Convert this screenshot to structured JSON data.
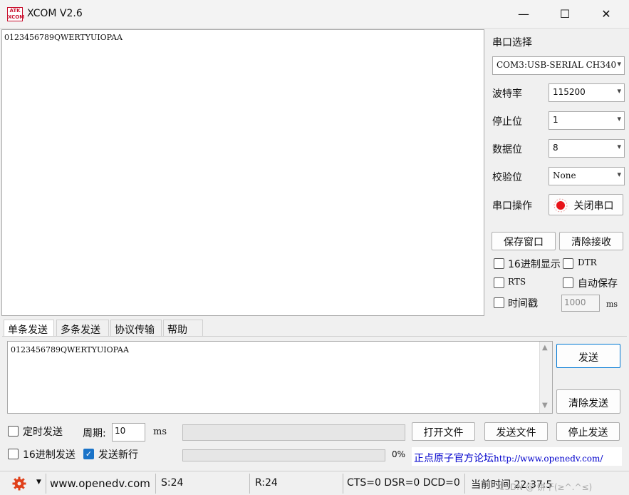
{
  "window": {
    "logo_text": "ATK XCOM",
    "title": "XCOM V2.6",
    "minimize": "—",
    "maximize": "☐",
    "close": "✕"
  },
  "receive": {
    "text": "0123456789QWERTYUIOPAA"
  },
  "panel": {
    "port_select_label": "串口选择",
    "port_value": "COM3:USB-SERIAL CH340",
    "baud_label": "波特率",
    "baud_value": "115200",
    "stop_label": "停止位",
    "stop_value": "1",
    "data_label": "数据位",
    "data_value": "8",
    "parity_label": "校验位",
    "parity_value": "None",
    "op_label": "串口操作",
    "op_button": "关闭串口",
    "save_window": "保存窗口",
    "clear_receive": "清除接收",
    "hex_display": "16进制显示",
    "dtr": "DTR",
    "rts": "RTS",
    "auto_save": "自动保存",
    "timestamp": "时间戳",
    "timestamp_ms_value": "1000",
    "ms_unit": "ms"
  },
  "tabs": [
    "单条发送",
    "多条发送",
    "协议传输",
    "帮助"
  ],
  "send": {
    "text": "0123456789QWERTYUIOPAA",
    "send_button": "发送",
    "clear_send": "清除发送",
    "timed_send": "定时发送",
    "period_label": "周期:",
    "period_value": "10",
    "period_unit": "ms",
    "open_file": "打开文件",
    "send_file": "发送文件",
    "stop_send": "停止发送",
    "hex_send": "16进制发送",
    "send_newline": "发送新行",
    "progress": "0%",
    "forum_link_prefix": "正点原子官方论坛",
    "forum_url": "http://www.openedv.com/"
  },
  "status": {
    "website": "www.openedv.com",
    "sent": "S:24",
    "received": "R:24",
    "signals": "CTS=0 DSR=0 DCD=0",
    "current_time": "当前时间 22:37:5",
    "watermark": "CSDN @ 饼干(≥^.^≤)"
  }
}
